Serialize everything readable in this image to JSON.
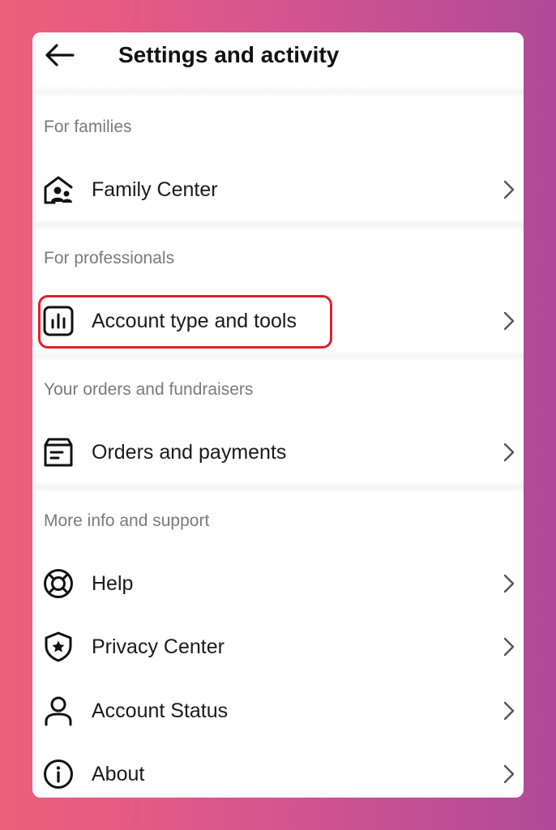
{
  "header": {
    "title": "Settings and activity",
    "back_icon": "arrow-left-icon"
  },
  "sections": [
    {
      "label": "For families",
      "items": [
        {
          "label": "Family Center",
          "icon": "family-home-icon"
        }
      ]
    },
    {
      "label": "For professionals",
      "items": [
        {
          "label": "Account type and tools",
          "icon": "bar-chart-icon",
          "highlighted": true
        }
      ]
    },
    {
      "label": "Your orders and fundraisers",
      "items": [
        {
          "label": "Orders and payments",
          "icon": "orders-box-icon"
        }
      ]
    },
    {
      "label": "More info and support",
      "items": [
        {
          "label": "Help",
          "icon": "lifebuoy-icon"
        },
        {
          "label": "Privacy Center",
          "icon": "shield-star-icon"
        },
        {
          "label": "Account Status",
          "icon": "person-icon"
        },
        {
          "label": "About",
          "icon": "info-icon"
        }
      ]
    }
  ],
  "colors": {
    "highlight_border": "#e0202a",
    "section_label": "#7a7a7a",
    "background_gradient_start": "#ef5f79",
    "background_gradient_end": "#b04a98"
  }
}
